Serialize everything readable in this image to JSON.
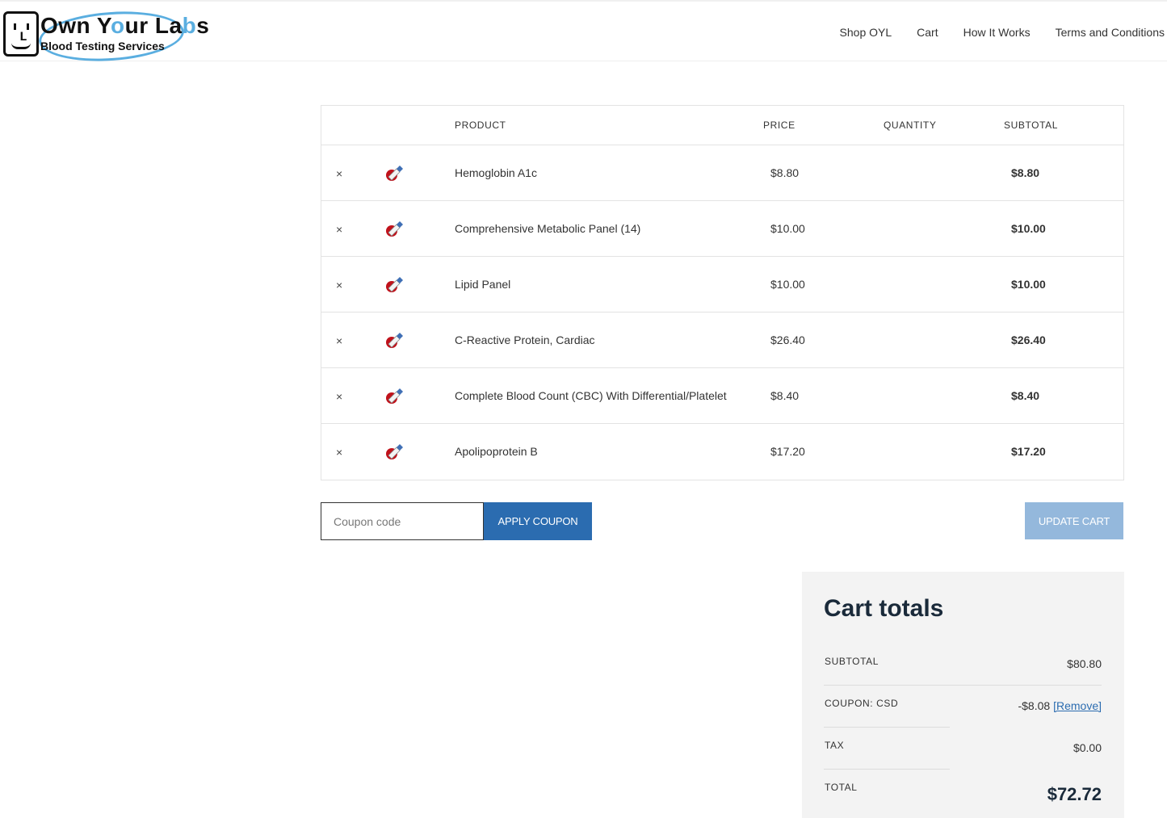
{
  "header": {
    "logo_title_part1": "Own Y",
    "logo_title_o": "o",
    "logo_title_part2": "ur La",
    "logo_title_b": "b",
    "logo_title_part3": "s",
    "logo_subtitle": "Blood Testing Services",
    "nav": [
      "Shop OYL",
      "Cart",
      "How It Works",
      "Terms and Conditions"
    ]
  },
  "cart_table": {
    "columns": {
      "product": "PRODUCT",
      "price": "PRICE",
      "quantity": "QUANTITY",
      "subtotal": "SUBTOTAL"
    },
    "remove_symbol": "×",
    "items": [
      {
        "name": "Hemoglobin A1c",
        "price": "$8.80",
        "subtotal": "$8.80"
      },
      {
        "name": "Comprehensive Metabolic Panel (14)",
        "price": "$10.00",
        "subtotal": "$10.00"
      },
      {
        "name": "Lipid Panel",
        "price": "$10.00",
        "subtotal": "$10.00"
      },
      {
        "name": "C-Reactive Protein, Cardiac",
        "price": "$26.40",
        "subtotal": "$26.40"
      },
      {
        "name": "Complete Blood Count (CBC) With Differential/Platelet",
        "price": "$8.40",
        "subtotal": "$8.40"
      },
      {
        "name": "Apolipoprotein B",
        "price": "$17.20",
        "subtotal": "$17.20"
      }
    ]
  },
  "coupon": {
    "placeholder": "Coupon code",
    "apply_label": "APPLY COUPON",
    "update_label": "UPDATE CART"
  },
  "totals": {
    "title": "Cart totals",
    "subtotal_label": "SUBTOTAL",
    "subtotal_value": "$80.80",
    "coupon_label": "COUPON: CSD",
    "coupon_value": "-$8.08",
    "coupon_remove": "[Remove]",
    "tax_label": "TAX",
    "tax_value": "$0.00",
    "total_label": "TOTAL",
    "total_value": "$72.72"
  },
  "colors": {
    "primary_button": "#2b6cb0",
    "disabled_button": "#94b8dc",
    "logo_accent": "#5aaee0",
    "heading": "#1a2a3a"
  }
}
